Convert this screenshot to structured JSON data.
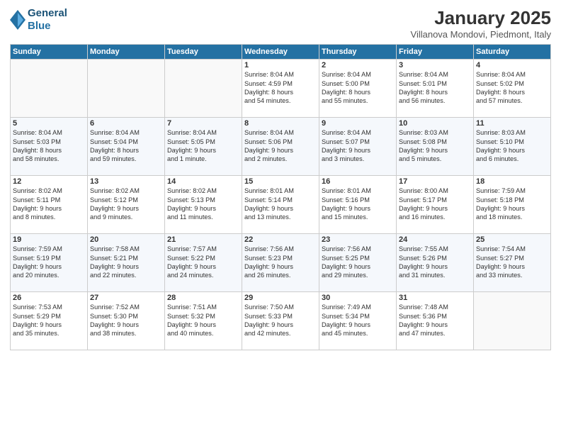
{
  "header": {
    "logo_line1": "General",
    "logo_line2": "Blue",
    "title": "January 2025",
    "subtitle": "Villanova Mondovi, Piedmont, Italy"
  },
  "weekdays": [
    "Sunday",
    "Monday",
    "Tuesday",
    "Wednesday",
    "Thursday",
    "Friday",
    "Saturday"
  ],
  "weeks": [
    [
      {
        "day": "",
        "info": ""
      },
      {
        "day": "",
        "info": ""
      },
      {
        "day": "",
        "info": ""
      },
      {
        "day": "1",
        "info": "Sunrise: 8:04 AM\nSunset: 4:59 PM\nDaylight: 8 hours\nand 54 minutes."
      },
      {
        "day": "2",
        "info": "Sunrise: 8:04 AM\nSunset: 5:00 PM\nDaylight: 8 hours\nand 55 minutes."
      },
      {
        "day": "3",
        "info": "Sunrise: 8:04 AM\nSunset: 5:01 PM\nDaylight: 8 hours\nand 56 minutes."
      },
      {
        "day": "4",
        "info": "Sunrise: 8:04 AM\nSunset: 5:02 PM\nDaylight: 8 hours\nand 57 minutes."
      }
    ],
    [
      {
        "day": "5",
        "info": "Sunrise: 8:04 AM\nSunset: 5:03 PM\nDaylight: 8 hours\nand 58 minutes."
      },
      {
        "day": "6",
        "info": "Sunrise: 8:04 AM\nSunset: 5:04 PM\nDaylight: 8 hours\nand 59 minutes."
      },
      {
        "day": "7",
        "info": "Sunrise: 8:04 AM\nSunset: 5:05 PM\nDaylight: 9 hours\nand 1 minute."
      },
      {
        "day": "8",
        "info": "Sunrise: 8:04 AM\nSunset: 5:06 PM\nDaylight: 9 hours\nand 2 minutes."
      },
      {
        "day": "9",
        "info": "Sunrise: 8:04 AM\nSunset: 5:07 PM\nDaylight: 9 hours\nand 3 minutes."
      },
      {
        "day": "10",
        "info": "Sunrise: 8:03 AM\nSunset: 5:08 PM\nDaylight: 9 hours\nand 5 minutes."
      },
      {
        "day": "11",
        "info": "Sunrise: 8:03 AM\nSunset: 5:10 PM\nDaylight: 9 hours\nand 6 minutes."
      }
    ],
    [
      {
        "day": "12",
        "info": "Sunrise: 8:02 AM\nSunset: 5:11 PM\nDaylight: 9 hours\nand 8 minutes."
      },
      {
        "day": "13",
        "info": "Sunrise: 8:02 AM\nSunset: 5:12 PM\nDaylight: 9 hours\nand 9 minutes."
      },
      {
        "day": "14",
        "info": "Sunrise: 8:02 AM\nSunset: 5:13 PM\nDaylight: 9 hours\nand 11 minutes."
      },
      {
        "day": "15",
        "info": "Sunrise: 8:01 AM\nSunset: 5:14 PM\nDaylight: 9 hours\nand 13 minutes."
      },
      {
        "day": "16",
        "info": "Sunrise: 8:01 AM\nSunset: 5:16 PM\nDaylight: 9 hours\nand 15 minutes."
      },
      {
        "day": "17",
        "info": "Sunrise: 8:00 AM\nSunset: 5:17 PM\nDaylight: 9 hours\nand 16 minutes."
      },
      {
        "day": "18",
        "info": "Sunrise: 7:59 AM\nSunset: 5:18 PM\nDaylight: 9 hours\nand 18 minutes."
      }
    ],
    [
      {
        "day": "19",
        "info": "Sunrise: 7:59 AM\nSunset: 5:19 PM\nDaylight: 9 hours\nand 20 minutes."
      },
      {
        "day": "20",
        "info": "Sunrise: 7:58 AM\nSunset: 5:21 PM\nDaylight: 9 hours\nand 22 minutes."
      },
      {
        "day": "21",
        "info": "Sunrise: 7:57 AM\nSunset: 5:22 PM\nDaylight: 9 hours\nand 24 minutes."
      },
      {
        "day": "22",
        "info": "Sunrise: 7:56 AM\nSunset: 5:23 PM\nDaylight: 9 hours\nand 26 minutes."
      },
      {
        "day": "23",
        "info": "Sunrise: 7:56 AM\nSunset: 5:25 PM\nDaylight: 9 hours\nand 29 minutes."
      },
      {
        "day": "24",
        "info": "Sunrise: 7:55 AM\nSunset: 5:26 PM\nDaylight: 9 hours\nand 31 minutes."
      },
      {
        "day": "25",
        "info": "Sunrise: 7:54 AM\nSunset: 5:27 PM\nDaylight: 9 hours\nand 33 minutes."
      }
    ],
    [
      {
        "day": "26",
        "info": "Sunrise: 7:53 AM\nSunset: 5:29 PM\nDaylight: 9 hours\nand 35 minutes."
      },
      {
        "day": "27",
        "info": "Sunrise: 7:52 AM\nSunset: 5:30 PM\nDaylight: 9 hours\nand 38 minutes."
      },
      {
        "day": "28",
        "info": "Sunrise: 7:51 AM\nSunset: 5:32 PM\nDaylight: 9 hours\nand 40 minutes."
      },
      {
        "day": "29",
        "info": "Sunrise: 7:50 AM\nSunset: 5:33 PM\nDaylight: 9 hours\nand 42 minutes."
      },
      {
        "day": "30",
        "info": "Sunrise: 7:49 AM\nSunset: 5:34 PM\nDaylight: 9 hours\nand 45 minutes."
      },
      {
        "day": "31",
        "info": "Sunrise: 7:48 AM\nSunset: 5:36 PM\nDaylight: 9 hours\nand 47 minutes."
      },
      {
        "day": "",
        "info": ""
      }
    ]
  ]
}
